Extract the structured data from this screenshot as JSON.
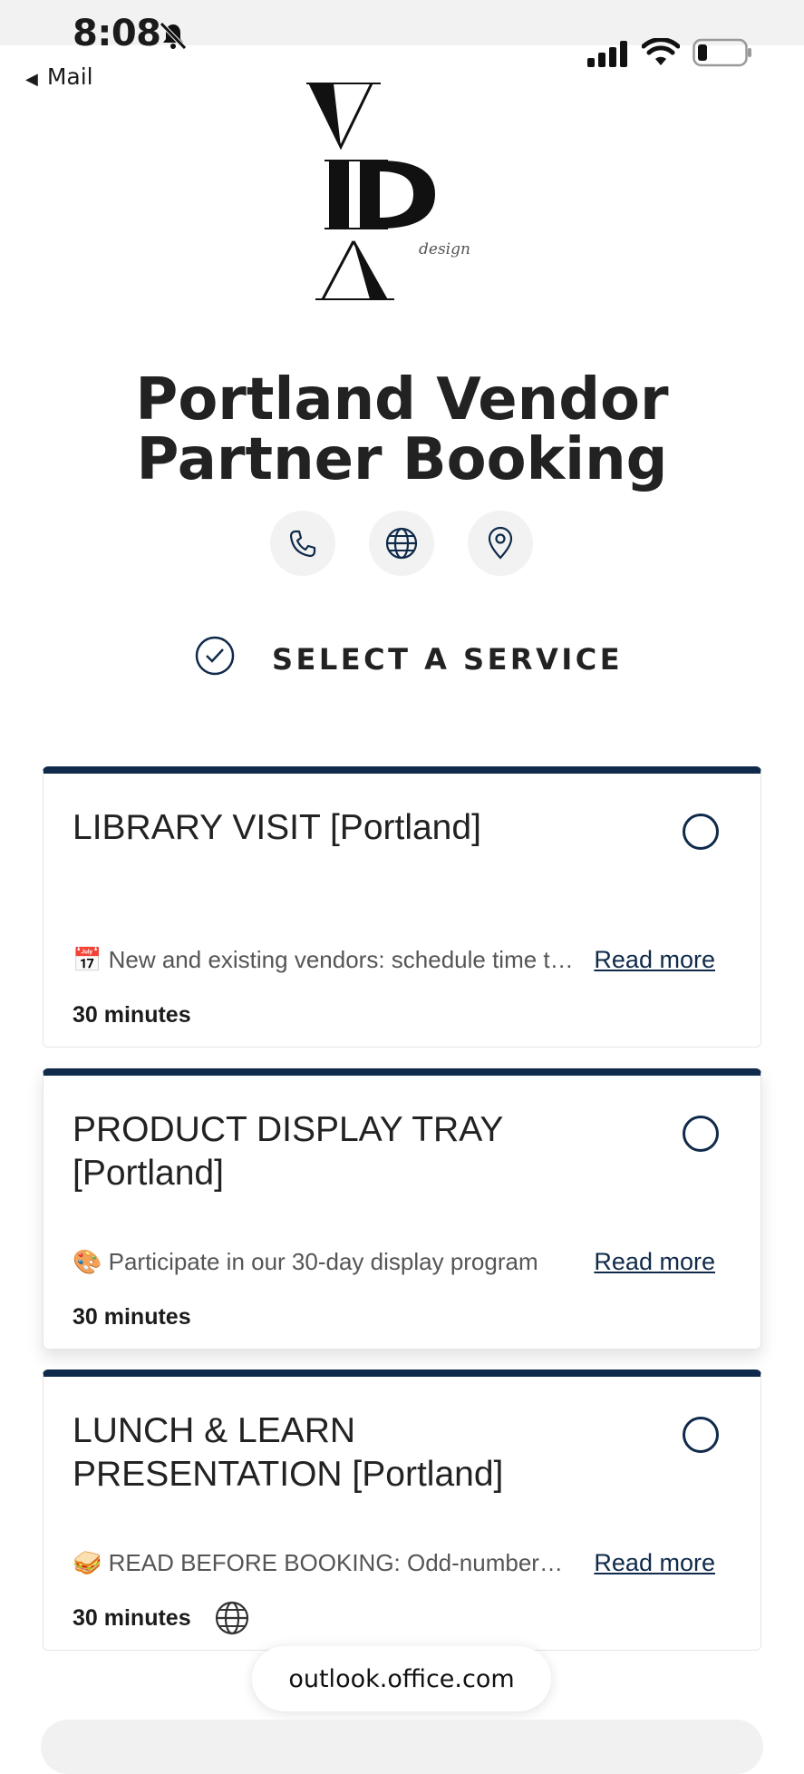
{
  "status": {
    "time": "8:08",
    "back_label": "Mail"
  },
  "logo": {
    "letters": "VIDA",
    "tagline": "design"
  },
  "page": {
    "title_line1": "Portland Vendor",
    "title_line2": "Partner Booking"
  },
  "contact_buttons": [
    "phone-icon",
    "globe-icon",
    "location-pin-icon"
  ],
  "section": {
    "heading": "SELECT A SERVICE"
  },
  "services": [
    {
      "name": "LIBRARY VISIT [Portland]",
      "emoji": "📅",
      "description": "New and existing vendors: schedule time to visit our library",
      "read_more": "Read more",
      "duration": "30 minutes"
    },
    {
      "name": "PRODUCT DISPLAY TRAY [Portland]",
      "emoji": "🎨",
      "description": "Participate in our 30-day display program",
      "read_more": "Read more",
      "duration": "30 minutes"
    },
    {
      "name": "LUNCH & LEARN PRESENTATION [Portland]",
      "emoji": "🥪",
      "description": "READ BEFORE BOOKING: Odd-numbered months only",
      "read_more": "Read more",
      "duration": "30 minutes",
      "online": true
    }
  ],
  "browser": {
    "url": "outlook.office.com"
  },
  "colors": {
    "accent": "#0f2a4a",
    "text": "#1b1b1b",
    "muted": "#555555"
  }
}
